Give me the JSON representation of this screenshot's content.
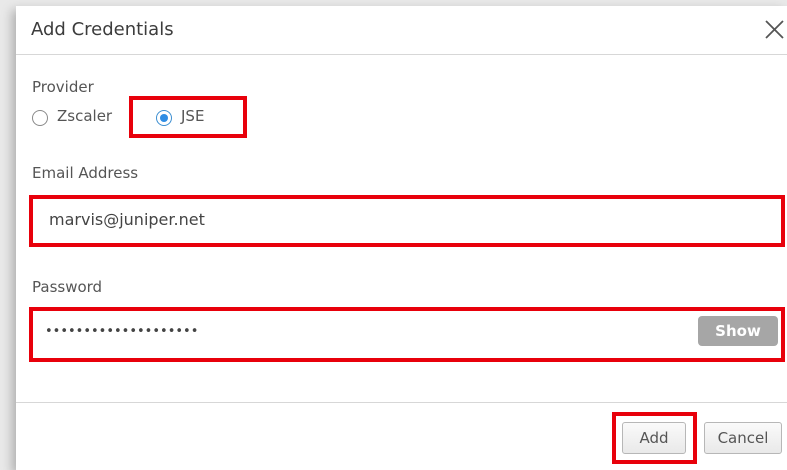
{
  "dialog": {
    "title": "Add Credentials",
    "close_icon": "close-icon"
  },
  "provider": {
    "label": "Provider",
    "options": [
      {
        "label": "Zscaler",
        "selected": false
      },
      {
        "label": "JSE",
        "selected": true
      }
    ]
  },
  "email": {
    "label": "Email Address",
    "value": "marvis@juniper.net"
  },
  "password": {
    "label": "Password",
    "masked_value": "••••••••••••••••••••",
    "show_label": "Show"
  },
  "footer": {
    "add_label": "Add",
    "cancel_label": "Cancel"
  },
  "colors": {
    "highlight": "#e8000b",
    "radio_selected": "#2f8de4",
    "show_button": "#a6a6a6"
  }
}
